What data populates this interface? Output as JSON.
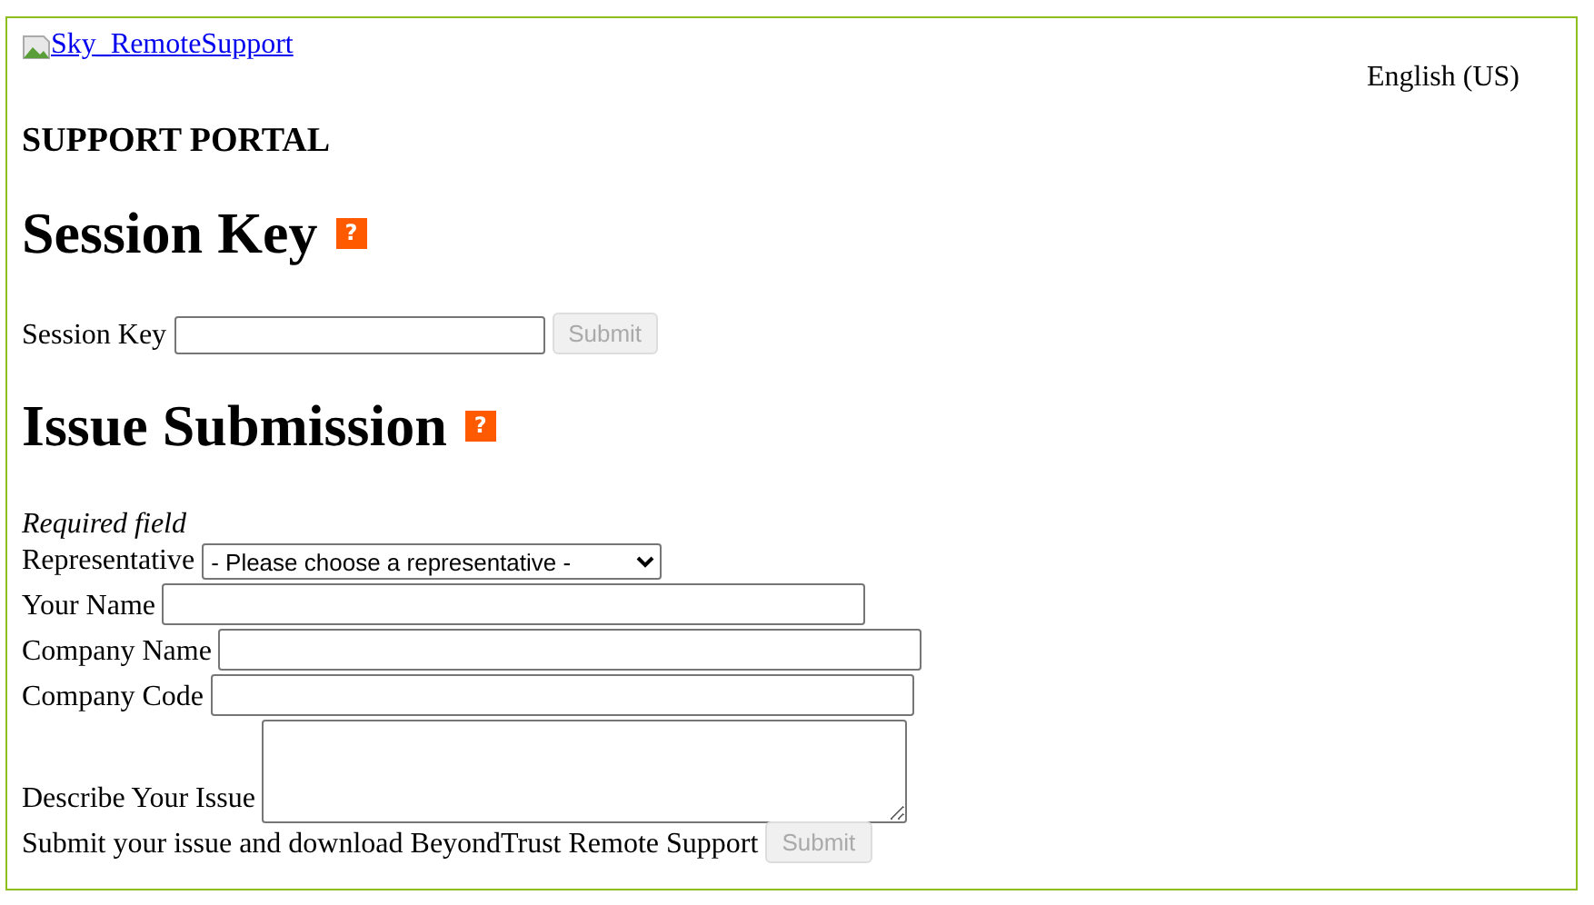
{
  "logo_link": {
    "text": "Sky_RemoteSupport"
  },
  "language": "English (US)",
  "portal_title": "SUPPORT PORTAL",
  "session_key_section": {
    "heading": "Session Key",
    "help": "?",
    "label": "Session Key",
    "submit": {
      "label": "Submit",
      "disabled": true
    }
  },
  "issue_section": {
    "heading": "Issue Submission",
    "help": "?",
    "note": "Required field",
    "fields": [
      {
        "kind": "select",
        "label": "Representative",
        "value": "- Please choose a representative -"
      },
      {
        "kind": "text",
        "label": "Your Name"
      },
      {
        "kind": "text",
        "label": "Company Name"
      },
      {
        "kind": "text",
        "label": "Company Code"
      },
      {
        "kind": "textarea",
        "label": "Describe Your Issue"
      }
    ],
    "submit_label": "Submit your issue and download BeyondTrust Remote Support",
    "submit": {
      "label": "Submit",
      "disabled": true
    }
  }
}
